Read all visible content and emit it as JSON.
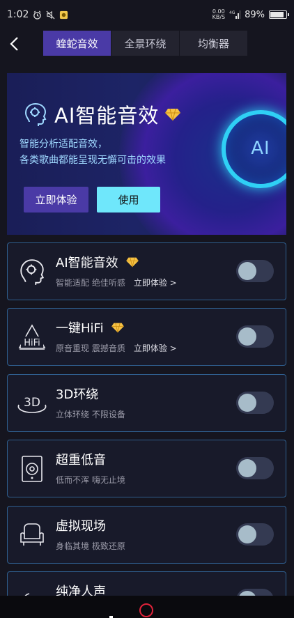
{
  "status_bar": {
    "time": "1:02",
    "net_speed_value": "0.00",
    "net_speed_unit": "KB/S",
    "signal": "4G",
    "battery": "89%",
    "battery_level": 0.89
  },
  "header": {
    "tabs": [
      {
        "label": "蝰蛇音效",
        "active": true
      },
      {
        "label": "全景环绕",
        "active": false
      },
      {
        "label": "均衡器",
        "active": false
      }
    ]
  },
  "banner": {
    "title": "AI智能音效",
    "desc_line1": "智能分析适配音效，",
    "desc_line2": "各类歌曲都能呈现无懈可击的效果",
    "try_button": "立即体验",
    "use_button": "使用",
    "orb_text": "AI"
  },
  "effects": [
    {
      "name": "AI智能音效",
      "premium": true,
      "subtitle": "智能适配 绝佳听感",
      "link": "立即体验 >",
      "icon": "ai-head-icon",
      "enabled": false
    },
    {
      "name": "一键HiFi",
      "premium": true,
      "subtitle": "原音重现 震撼音质",
      "link": "立即体验 >",
      "icon": "hifi-icon",
      "enabled": false,
      "icon_text": "HiFi"
    },
    {
      "name": "3D环绕",
      "premium": false,
      "subtitle": "立体环绕 不限设备",
      "link": "",
      "icon": "3d-surround-icon",
      "enabled": false,
      "icon_text": "3D"
    },
    {
      "name": "超重低音",
      "premium": false,
      "subtitle": "低而不浑 嗨无止境",
      "link": "",
      "icon": "speaker-icon",
      "enabled": false
    },
    {
      "name": "虚拟现场",
      "premium": false,
      "subtitle": "身临其境 极致还原",
      "link": "",
      "icon": "armchair-icon",
      "enabled": false
    },
    {
      "name": "纯净人声",
      "premium": false,
      "subtitle": "",
      "link": "",
      "icon": "voice-icon",
      "enabled": false
    }
  ],
  "colors": {
    "accent": "#4a3aa6",
    "use_button": "#6fe7fb",
    "card_border": "#2f5f8f",
    "premium_gold": "#f6c244"
  }
}
